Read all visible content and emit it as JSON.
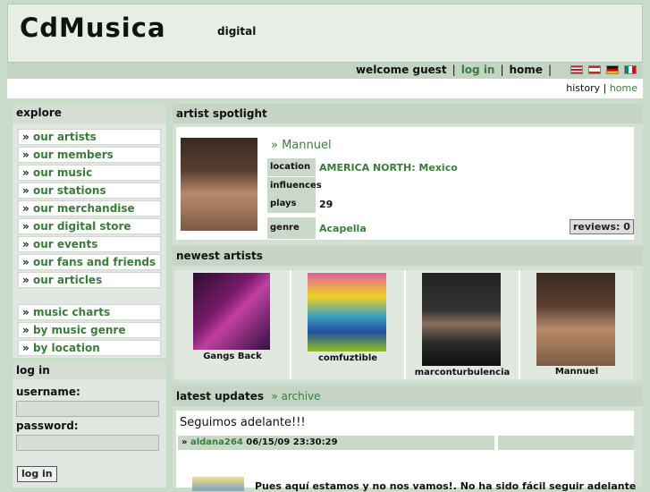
{
  "header": {
    "logo": "CdMusica",
    "tagline": "digital"
  },
  "topnav": {
    "welcome": "welcome guest",
    "login": "log in",
    "home": "home"
  },
  "subnav": {
    "history": "history",
    "home": "home"
  },
  "sidebar": {
    "explore_title": "explore",
    "items": [
      {
        "label": "our artists"
      },
      {
        "label": "our members"
      },
      {
        "label": "our music"
      },
      {
        "label": "our stations"
      },
      {
        "label": "our merchandise"
      },
      {
        "label": "our digital store"
      },
      {
        "label": "our events"
      },
      {
        "label": "our fans and friends"
      },
      {
        "label": "our articles"
      }
    ],
    "charts": [
      {
        "label": "music charts"
      },
      {
        "label": "by music genre"
      },
      {
        "label": "by location"
      }
    ],
    "marker": "»"
  },
  "login": {
    "title": "log in",
    "username_label": "username:",
    "password_label": "password:",
    "button": "log in"
  },
  "spotlight": {
    "title": "artist spotlight",
    "name": "» Mannuel",
    "rows": [
      {
        "key": "location",
        "value": "AMERICA NORTH: Mexico"
      },
      {
        "key": "influences",
        "value": ""
      },
      {
        "key": "plays",
        "value": "29"
      },
      {
        "key": "genre",
        "value": "Acapella"
      }
    ],
    "reviews": "reviews: 0"
  },
  "newest": {
    "title": "newest artists",
    "artists": [
      {
        "name": "Gangs Back"
      },
      {
        "name": "comfuztible"
      },
      {
        "name": "marconturbulencia"
      },
      {
        "name": "Mannuel"
      }
    ]
  },
  "updates": {
    "title": "latest updates",
    "archive": "» archive",
    "post_title": "Seguimos adelante!!!",
    "marker": "»",
    "author": "aldana264",
    "date": "06/15/09 23:30:29",
    "body": "Pues aquí estamos y no nos vamos!. No ha sido fácil seguir adelante"
  },
  "colors": {
    "accent": "#3a7d3a",
    "panel": "#c9dcc9"
  }
}
